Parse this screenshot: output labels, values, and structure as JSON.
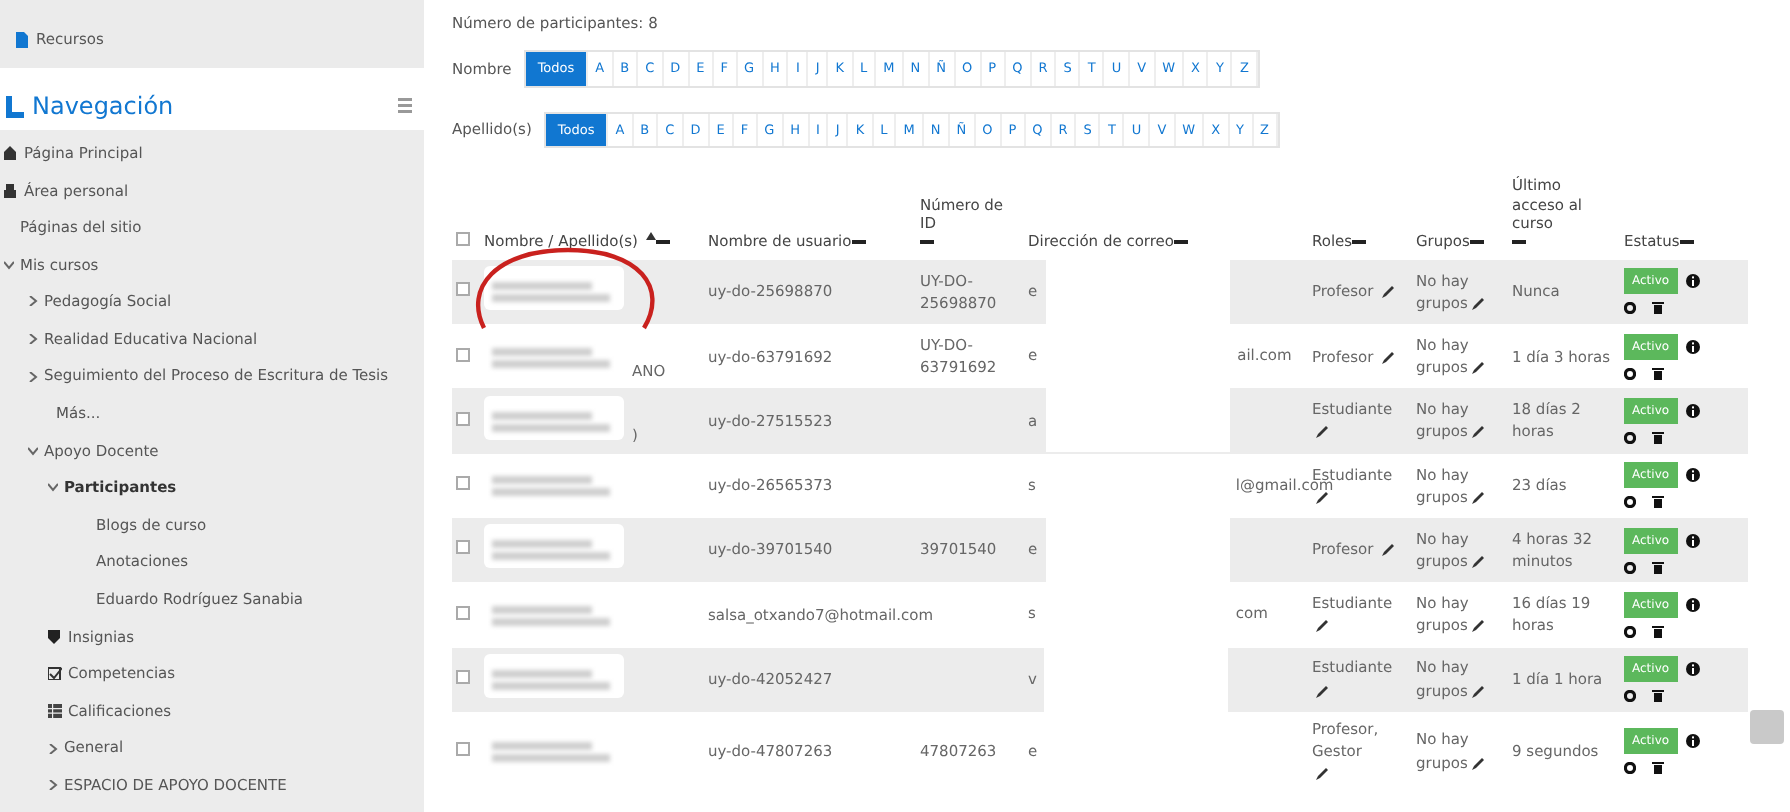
{
  "sidebar": {
    "top_items": [
      {
        "label": "Recursos"
      }
    ],
    "nav": {
      "title": "Navegación",
      "items": [
        {
          "label": "Página Principal",
          "kind": "home",
          "selected": false
        },
        {
          "label": "Área personal",
          "kind": "dashboard",
          "selected": false
        },
        {
          "label": "Páginas del sitio",
          "kind": "link",
          "selected": false
        },
        {
          "label": "Mis cursos",
          "kind": "branch",
          "expanded": true,
          "selected": false,
          "children": [
            {
              "label": "Pedagogía Social",
              "kind": "branch",
              "expanded": false,
              "selected": false
            },
            {
              "label": "Realidad Educativa Nacional",
              "kind": "branch",
              "expanded": false,
              "selected": false
            },
            {
              "label": "Seguimiento del Proceso de Escritura de Tesis",
              "kind": "branch",
              "expanded": false,
              "selected": false
            },
            {
              "label": "Más...",
              "kind": "link",
              "selected": false
            },
            {
              "label": "Apoyo Docente",
              "kind": "branch",
              "expanded": true,
              "selected": false,
              "children": [
                {
                  "label": "Participantes",
                  "kind": "branch",
                  "expanded": true,
                  "selected": true,
                  "children": [
                    {
                      "label": "Blogs de curso",
                      "kind": "link",
                      "selected": false
                    },
                    {
                      "label": "Anotaciones",
                      "kind": "link",
                      "selected": false
                    },
                    {
                      "label": "Eduardo Rodríguez Sanabia",
                      "kind": "link",
                      "selected": false
                    }
                  ]
                },
                {
                  "label": "Insignias",
                  "kind": "badge",
                  "selected": false
                },
                {
                  "label": "Competencias",
                  "kind": "competency",
                  "selected": false
                },
                {
                  "label": "Calificaciones",
                  "kind": "grades",
                  "selected": false
                },
                {
                  "label": "General",
                  "kind": "branch",
                  "expanded": false,
                  "selected": false
                },
                {
                  "label": "ESPACIO DE APOYO DOCENTE",
                  "kind": "branch",
                  "expanded": false,
                  "selected": false
                }
              ]
            }
          ]
        }
      ]
    }
  },
  "participant_count": "Número de participantes: 8",
  "filters": [
    {
      "label": "Nombre",
      "letters": [
        {
          "label": "Todos",
          "selected": true
        },
        {
          "label": "A",
          "selected": false
        },
        {
          "label": "B",
          "selected": false
        },
        {
          "label": "C",
          "selected": false
        },
        {
          "label": "D",
          "selected": false
        },
        {
          "label": "E",
          "selected": false
        },
        {
          "label": "F",
          "selected": false
        },
        {
          "label": "G",
          "selected": false
        },
        {
          "label": "H",
          "selected": false
        },
        {
          "label": "I",
          "selected": false
        },
        {
          "label": "J",
          "selected": false
        },
        {
          "label": "K",
          "selected": false
        },
        {
          "label": "L",
          "selected": false
        },
        {
          "label": "M",
          "selected": false
        },
        {
          "label": "N",
          "selected": false
        },
        {
          "label": "Ñ",
          "selected": false
        },
        {
          "label": "O",
          "selected": false
        },
        {
          "label": "P",
          "selected": false
        },
        {
          "label": "Q",
          "selected": false
        },
        {
          "label": "R",
          "selected": false
        },
        {
          "label": "S",
          "selected": false
        },
        {
          "label": "T",
          "selected": false
        },
        {
          "label": "U",
          "selected": false
        },
        {
          "label": "V",
          "selected": false
        },
        {
          "label": "W",
          "selected": false
        },
        {
          "label": "X",
          "selected": false
        },
        {
          "label": "Y",
          "selected": false
        },
        {
          "label": "Z",
          "selected": false
        }
      ]
    },
    {
      "label": "Apellido(s)",
      "letters": [
        {
          "label": "Todos",
          "selected": true
        },
        {
          "label": "A",
          "selected": false
        },
        {
          "label": "B",
          "selected": false
        },
        {
          "label": "C",
          "selected": false
        },
        {
          "label": "D",
          "selected": false
        },
        {
          "label": "E",
          "selected": false
        },
        {
          "label": "F",
          "selected": false
        },
        {
          "label": "G",
          "selected": false
        },
        {
          "label": "H",
          "selected": false
        },
        {
          "label": "I",
          "selected": false
        },
        {
          "label": "J",
          "selected": false
        },
        {
          "label": "K",
          "selected": false
        },
        {
          "label": "L",
          "selected": false
        },
        {
          "label": "M",
          "selected": false
        },
        {
          "label": "N",
          "selected": false
        },
        {
          "label": "Ñ",
          "selected": false
        },
        {
          "label": "O",
          "selected": false
        },
        {
          "label": "P",
          "selected": false
        },
        {
          "label": "Q",
          "selected": false
        },
        {
          "label": "R",
          "selected": false
        },
        {
          "label": "S",
          "selected": false
        },
        {
          "label": "T",
          "selected": false
        },
        {
          "label": "U",
          "selected": false
        },
        {
          "label": "V",
          "selected": false
        },
        {
          "label": "W",
          "selected": false
        },
        {
          "label": "X",
          "selected": false
        },
        {
          "label": "Y",
          "selected": false
        },
        {
          "label": "Z",
          "selected": false
        }
      ]
    }
  ],
  "table": {
    "select_all_checked": false,
    "columns": [
      {
        "label": "Nombre / Apellido(s)",
        "sorted": true
      },
      {
        "label": "Nombre de usuario",
        "sorted": false
      },
      {
        "label": "Número de ID",
        "sorted": false
      },
      {
        "label": "Dirección de correo",
        "sorted": false
      },
      {
        "label": "Roles",
        "sorted": false
      },
      {
        "label": "Grupos",
        "sorted": false
      },
      {
        "label": "Último acceso al curso",
        "sorted": false
      },
      {
        "label": "Estatus",
        "sorted": false
      }
    ],
    "rows": [
      {
        "checked": false,
        "annotated": true,
        "username": "uy-do-25698870",
        "id": "UY-DO-25698870",
        "email_start": "e",
        "roles": "Profesor",
        "groups": "No hay grupos",
        "last_access": "Nunca",
        "status": "Activo"
      },
      {
        "checked": false,
        "annotated": false,
        "name_fragment": "ANO",
        "username": "uy-do-63791692",
        "id": "UY-DO-63791692",
        "email_start": "e",
        "email_end": "ail.com",
        "roles": "Profesor",
        "groups": "No hay grupos",
        "last_access": "1 día 3 horas",
        "status": "Activo"
      },
      {
        "checked": false,
        "annotated": false,
        "name_fragment": ")",
        "username": "uy-do-27515523",
        "email_start": "a",
        "roles": "Estudiante",
        "groups": "No hay grupos",
        "last_access": "18 días 2 horas",
        "status": "Activo"
      },
      {
        "checked": false,
        "annotated": false,
        "username": "uy-do-26565373",
        "email_start": "s",
        "email_end": "l@gmail.com",
        "roles": "Estudiante",
        "groups": "No hay grupos",
        "last_access": "23 días",
        "status": "Activo"
      },
      {
        "checked": false,
        "annotated": false,
        "username": "uy-do-39701540",
        "id": "39701540",
        "email_start": "e",
        "roles": "Profesor",
        "groups": "No hay grupos",
        "last_access": "4 horas 32 minutos",
        "status": "Activo"
      },
      {
        "checked": false,
        "annotated": false,
        "username": "salsa_otxando7@hotmail.com",
        "email_start": "s",
        "email_end": "com",
        "roles": "Estudiante",
        "groups": "No hay grupos",
        "last_access": "16 días 19 horas",
        "status": "Activo"
      },
      {
        "checked": false,
        "annotated": false,
        "username": "uy-do-42052427",
        "email_start": "v",
        "roles": "Estudiante",
        "groups": "No hay grupos",
        "last_access": "1 día 1 hora",
        "status": "Activo"
      },
      {
        "checked": false,
        "annotated": false,
        "username": "uy-do-47807263",
        "id": "47807263",
        "email_start": "e",
        "roles": "Profesor, Gestor",
        "groups": "No hay grupos",
        "last_access": "9 segundos",
        "status": "Activo"
      }
    ]
  }
}
